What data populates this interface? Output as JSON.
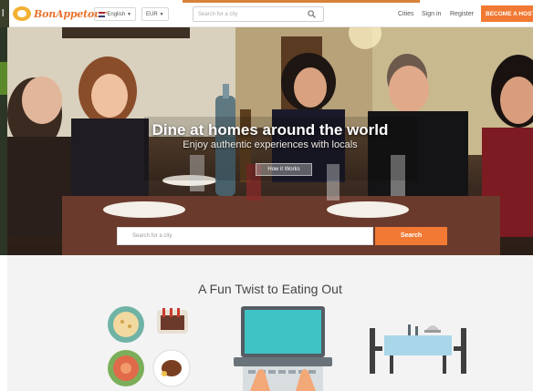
{
  "nav": {
    "logo_text": "BonAppetour",
    "language": "English",
    "currency": "EUR",
    "search_placeholder": "Search for a city",
    "links": {
      "cities": "Cities",
      "sign_in": "Sign in",
      "register": "Register"
    },
    "host_button": "BECOME A HOST",
    "accent": "#f27933"
  },
  "hero": {
    "title": "Dine at homes around the world",
    "subtitle": "Enjoy authentic experiences with locals",
    "how_button": "How it Works",
    "search_placeholder": "Search for a city",
    "search_button": "Search"
  },
  "section": {
    "title": "A Fun Twist to Eating Out",
    "illustrations": [
      "food-plates-illustration",
      "laptop-illustration",
      "dining-table-illustration"
    ]
  }
}
